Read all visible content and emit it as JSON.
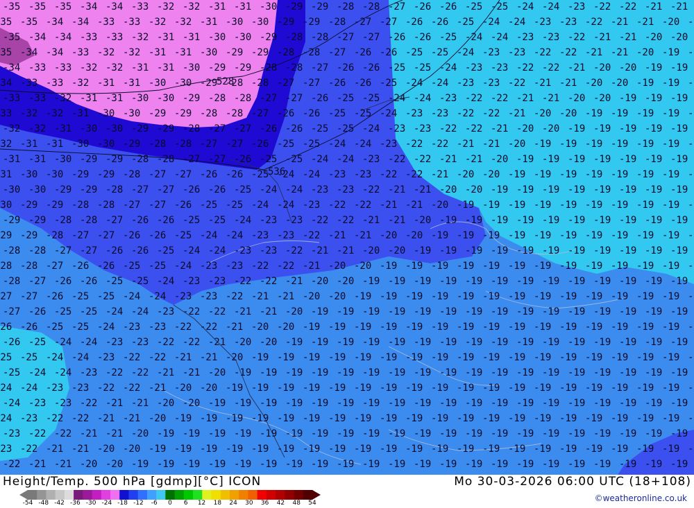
{
  "map": {
    "title": "Height/Temp. 500 hPa [gdmp][°C] ICON",
    "valid_time": "Mo 30-03-2026 06:00 UTC (18+108)",
    "credit": "©weatheronline.co.uk",
    "contour_labels": [
      "528",
      "536"
    ],
    "isotherm_labels": [
      "-35",
      "-34",
      "-33",
      "-32",
      "-31",
      "-30",
      "-29",
      "-28",
      "-27",
      "-26",
      "-25",
      "-24",
      "-23",
      "-22",
      "-21",
      "-20",
      "-19"
    ]
  },
  "legend": {
    "ticks": [
      "-54",
      "-48",
      "-42",
      "-36",
      "-30",
      "-24",
      "-18",
      "-12",
      "-6",
      "0",
      "6",
      "12",
      "18",
      "24",
      "30",
      "36",
      "42",
      "48",
      "54"
    ],
    "colors": [
      "#7a7a7a",
      "#959595",
      "#b0b0b0",
      "#c8c8c8",
      "#dcdcdc",
      "#7a1a7a",
      "#9a1a9a",
      "#c21ec2",
      "#e040e0",
      "#f070f0",
      "#1010d0",
      "#2040f0",
      "#3070ff",
      "#40a0ff",
      "#40c8f0",
      "#007000",
      "#00a000",
      "#00c800",
      "#20e020",
      "#e0f020",
      "#f0e000",
      "#f0c000",
      "#f0a000",
      "#f08000",
      "#f06000",
      "#f00000",
      "#d00000",
      "#b00000",
      "#900000",
      "#700000",
      "#500000"
    ]
  },
  "colors": {
    "band_m36": "#ee82ee",
    "band_m30": "#1e0ad2",
    "band_m24": "#3c50f0",
    "band_m21": "#3c8cf0",
    "band_m18": "#32c8f0"
  }
}
